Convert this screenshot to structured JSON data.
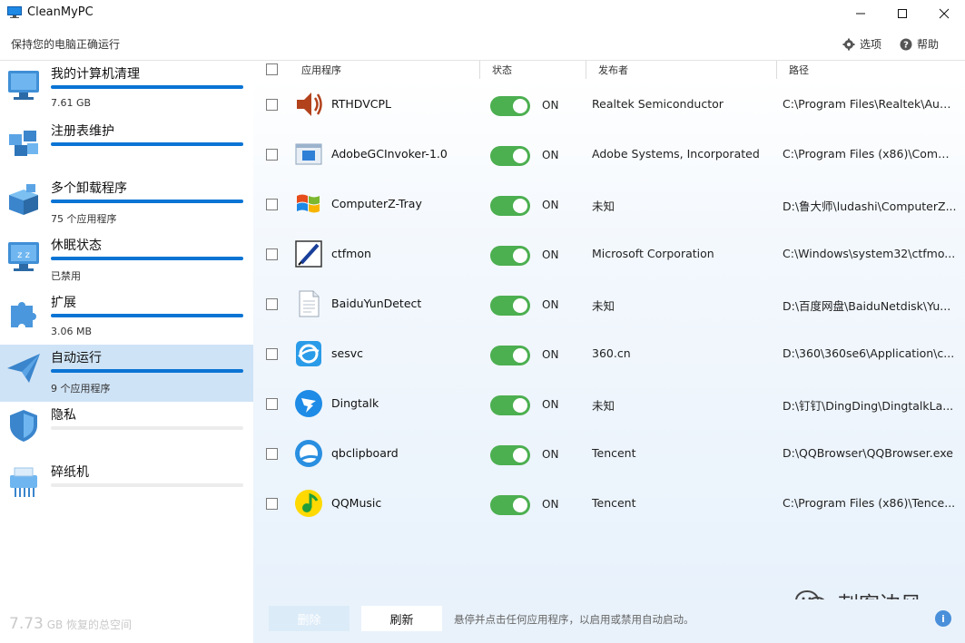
{
  "window": {
    "title": "CleanMyPC",
    "subtitle": "保持您的电脑正确运行",
    "controls": {
      "minimize": "—",
      "maximize": "☐",
      "close": "✕"
    }
  },
  "top_actions": {
    "options_label": "选项",
    "help_label": "帮助"
  },
  "sidebar": {
    "items": [
      {
        "label": "我的计算机清理",
        "sub": "7.61 GB",
        "icon": "computer-icon",
        "progress": 1.0
      },
      {
        "label": "注册表维护",
        "sub": "",
        "icon": "registry-cubes-icon",
        "progress": 1.0
      },
      {
        "label": "多个卸载程序",
        "sub": "75 个应用程序",
        "icon": "uninstaller-box-icon",
        "progress": 1.0
      },
      {
        "label": "休眠状态",
        "sub": "已禁用",
        "icon": "hibernation-monitor-icon",
        "progress": 1.0
      },
      {
        "label": "扩展",
        "sub": "3.06 MB",
        "icon": "puzzle-icon",
        "progress": 1.0
      },
      {
        "label": "自动运行",
        "sub": "9 个应用程序",
        "icon": "paper-plane-icon",
        "progress": 1.0,
        "active": true
      },
      {
        "label": "隐私",
        "sub": "",
        "icon": "shield-broom-icon",
        "progress": 0
      },
      {
        "label": "碎纸机",
        "sub": "",
        "icon": "shredder-icon",
        "progress": 0
      }
    ],
    "footer": {
      "amount": "7.73",
      "unit": "GB",
      "text": "恢复的总空间"
    }
  },
  "table": {
    "headers": {
      "app": "应用程序",
      "status": "状态",
      "publisher": "发布者",
      "path": "路径"
    },
    "rows": [
      {
        "name": "RTHDVCPL",
        "state": "ON",
        "publisher": "Realtek Semiconductor",
        "path": "C:\\Program Files\\Realtek\\Aud...",
        "icon": "speaker-icon"
      },
      {
        "name": "AdobeGCInvoker-1.0",
        "state": "ON",
        "publisher": "Adobe Systems, Incorporated",
        "path": "C:\\Program Files (x86)\\Comm...",
        "icon": "window-app-icon"
      },
      {
        "name": "ComputerZ-Tray",
        "state": "ON",
        "publisher": "未知",
        "path": "D:\\鲁大师\\ludashi\\ComputerZ...",
        "icon": "windows-flag-icon"
      },
      {
        "name": "ctfmon",
        "state": "ON",
        "publisher": "Microsoft Corporation",
        "path": "C:\\Windows\\system32\\ctfmo...",
        "icon": "pen-tablet-icon"
      },
      {
        "name": "BaiduYunDetect",
        "state": "ON",
        "publisher": "未知",
        "path": "D:\\百度网盘\\BaiduNetdisk\\Yu...",
        "icon": "document-icon"
      },
      {
        "name": "sesvc",
        "state": "ON",
        "publisher": "360.cn",
        "path": "D:\\360\\360se6\\Application\\c...",
        "icon": "browser-360-icon"
      },
      {
        "name": "Dingtalk",
        "state": "ON",
        "publisher": "未知",
        "path": "D:\\钉钉\\DingDing\\DingtalkLa...",
        "icon": "dingtalk-icon"
      },
      {
        "name": "qbclipboard",
        "state": "ON",
        "publisher": "Tencent",
        "path": "D:\\QQBrowser\\QQBrowser.exe",
        "icon": "qq-browser-icon"
      },
      {
        "name": "QQMusic",
        "state": "ON",
        "publisher": "Tencent",
        "path": "C:\\Program Files (x86)\\Tence...",
        "icon": "qq-music-icon"
      }
    ]
  },
  "footer": {
    "remove_label": "删除",
    "refresh_label": "刷新",
    "hint": "悬停并点击任何应用程序，以启用或禁用自动启动。",
    "info": "i"
  },
  "watermark": {
    "text": "刺客边风"
  },
  "colors": {
    "accent": "#0a74d4",
    "toggle_on": "#4caf50",
    "active_nav": "#cfe3f6"
  }
}
